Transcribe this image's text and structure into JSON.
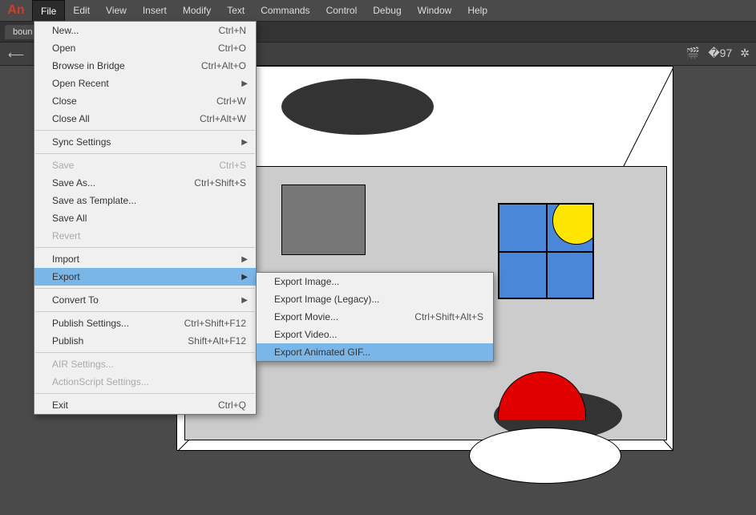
{
  "logo": "An",
  "menubar": [
    "File",
    "Edit",
    "View",
    "Insert",
    "Modify",
    "Text",
    "Commands",
    "Control",
    "Debug",
    "Window",
    "Help"
  ],
  "active_menu_index": 0,
  "tab": "boun…",
  "right_icons": [
    "clapper-icon",
    "paint-icon",
    "gear-icon"
  ],
  "file_menu": [
    {
      "label": "New...",
      "shortcut": "Ctrl+N"
    },
    {
      "label": "Open",
      "shortcut": "Ctrl+O"
    },
    {
      "label": "Browse in Bridge",
      "shortcut": "Ctrl+Alt+O"
    },
    {
      "label": "Open Recent",
      "submenu": true
    },
    {
      "label": "Close",
      "shortcut": "Ctrl+W"
    },
    {
      "label": "Close All",
      "shortcut": "Ctrl+Alt+W"
    },
    {
      "sep": true
    },
    {
      "label": "Sync Settings",
      "submenu": true
    },
    {
      "sep": true
    },
    {
      "label": "Save",
      "shortcut": "Ctrl+S",
      "disabled": true
    },
    {
      "label": "Save As...",
      "shortcut": "Ctrl+Shift+S"
    },
    {
      "label": "Save as Template..."
    },
    {
      "label": "Save All"
    },
    {
      "label": "Revert",
      "disabled": true
    },
    {
      "sep": true
    },
    {
      "label": "Import",
      "submenu": true
    },
    {
      "label": "Export",
      "submenu": true,
      "highlight": true
    },
    {
      "sep": true
    },
    {
      "label": "Convert To",
      "submenu": true
    },
    {
      "sep": true
    },
    {
      "label": "Publish Settings...",
      "shortcut": "Ctrl+Shift+F12"
    },
    {
      "label": "Publish",
      "shortcut": "Shift+Alt+F12"
    },
    {
      "sep": true
    },
    {
      "label": "AIR Settings...",
      "disabled": true
    },
    {
      "label": "ActionScript Settings...",
      "disabled": true
    },
    {
      "sep": true
    },
    {
      "label": "Exit",
      "shortcut": "Ctrl+Q"
    }
  ],
  "export_menu": [
    {
      "label": "Export Image..."
    },
    {
      "label": "Export Image (Legacy)..."
    },
    {
      "label": "Export Movie...",
      "shortcut": "Ctrl+Shift+Alt+S"
    },
    {
      "label": "Export Video..."
    },
    {
      "label": "Export Animated GIF...",
      "highlight": true
    }
  ]
}
